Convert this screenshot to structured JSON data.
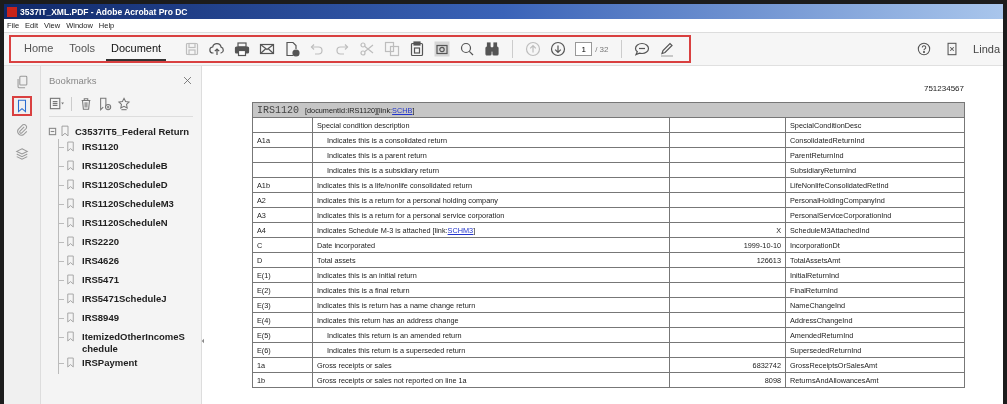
{
  "window": {
    "title": "3537IT_XML.PDF - Adobe Acrobat Pro DC"
  },
  "menu": [
    "File",
    "Edit",
    "View",
    "Window",
    "Help"
  ],
  "toolbar": {
    "tabs": [
      {
        "label": "Home",
        "selected": false
      },
      {
        "label": "Tools",
        "selected": false
      },
      {
        "label": "Document",
        "selected": true
      }
    ],
    "tools": [
      {
        "kind": "floppy-disk",
        "disabled": true
      },
      {
        "kind": "cloud-upload",
        "disabled": false
      },
      {
        "kind": "printer",
        "disabled": false
      },
      {
        "kind": "envelope",
        "disabled": false
      },
      {
        "kind": "file-check",
        "disabled": false
      },
      {
        "kind": "undo",
        "disabled": true
      },
      {
        "kind": "redo",
        "disabled": true
      },
      {
        "kind": "scissors",
        "disabled": true
      },
      {
        "kind": "copy",
        "disabled": true
      },
      {
        "kind": "clipboard",
        "disabled": false
      },
      {
        "kind": "camera",
        "disabled": false
      },
      {
        "kind": "search",
        "disabled": false
      },
      {
        "kind": "binoculars",
        "disabled": false
      },
      {
        "kind": "separator"
      },
      {
        "kind": "arrow-up-circle",
        "disabled": true
      },
      {
        "kind": "arrow-down-circle",
        "disabled": false
      },
      {
        "kind": "page",
        "value": "1",
        "total": "/ 32"
      },
      {
        "kind": "separator"
      },
      {
        "kind": "speech-bubble",
        "disabled": false
      },
      {
        "kind": "pen",
        "disabled": false
      }
    ],
    "user": "Linda"
  },
  "rail": [
    {
      "kind": "pages",
      "selected": false
    },
    {
      "kind": "bookmark",
      "selected": true
    },
    {
      "kind": "paperclip",
      "selected": false
    },
    {
      "kind": "layers",
      "selected": false
    }
  ],
  "bookmarks": {
    "title": "Bookmarks",
    "tree": {
      "label": "C3537IT5_Federal Return",
      "expanded": true,
      "children": [
        {
          "label": "IRS1120"
        },
        {
          "label": "IRS1120ScheduleB"
        },
        {
          "label": "IRS1120ScheduleD"
        },
        {
          "label": "IRS1120ScheduleM3"
        },
        {
          "label": "IRS1120ScheduleN"
        },
        {
          "label": "IRS2220"
        },
        {
          "label": "IRS4626"
        },
        {
          "label": "IRS5471"
        },
        {
          "label": "IRS5471ScheduleJ"
        },
        {
          "label": "IRS8949"
        },
        {
          "label": "ItemizedOtherIncomeSchedule"
        },
        {
          "label": "IRSPayment"
        }
      ]
    }
  },
  "document": {
    "page_number": "751234567",
    "table": {
      "form": "IRS1120",
      "header_text": "[documentId:IRS1120][link:",
      "header_link": "SCHB",
      "header_end": "]",
      "rows": [
        {
          "line": "",
          "description": "Special condition description",
          "indented": false,
          "value": "",
          "tag": "SpecialConditionDesc"
        },
        {
          "line": "A1a",
          "description": "Indicates this is a consolidated return",
          "indented": true,
          "value": "",
          "tag": "ConsolidatedReturnInd"
        },
        {
          "line": "",
          "description": "Indicates this is a parent return",
          "indented": true,
          "value": "",
          "tag": "ParentReturnInd"
        },
        {
          "line": "",
          "description": "Indicates this is a subsidiary return",
          "indented": true,
          "value": "",
          "tag": "SubsidiaryReturnInd"
        },
        {
          "line": "A1b",
          "description": "Indicates this is a life/nonlife consolidated return",
          "indented": false,
          "value": "",
          "tag": "LifeNonlifeConsolidatedRetInd"
        },
        {
          "line": "A2",
          "description": "Indicates this is a return for a personal holding company",
          "indented": false,
          "value": "",
          "tag": "PersonalHoldingCompanyInd"
        },
        {
          "line": "A3",
          "description": "Indicates this is a return for a personal service corporation",
          "indented": false,
          "value": "",
          "tag": "PersonalServiceCorporationInd"
        },
        {
          "line": "A4",
          "description": "Indicates Schedule M-3 is attached [link:",
          "link": "SCHM3",
          "description_end": "]",
          "indented": false,
          "value": "X",
          "tag": "ScheduleM3AttachedInd"
        },
        {
          "line": "C",
          "description": "Date incorporated",
          "indented": false,
          "value": "1999-10-10",
          "tag": "IncorporationDt"
        },
        {
          "line": "D",
          "description": "Total assets",
          "indented": false,
          "value": "126613",
          "tag": "TotalAssetsAmt"
        },
        {
          "line": "E(1)",
          "description": "Indicates this is an initial return",
          "indented": false,
          "value": "",
          "tag": "InitialReturnInd"
        },
        {
          "line": "E(2)",
          "description": "Indicates this is a final return",
          "indented": false,
          "value": "",
          "tag": "FinalReturnInd"
        },
        {
          "line": "E(3)",
          "description": "Indicates this is return has a name change return",
          "indented": false,
          "value": "",
          "tag": "NameChangeInd"
        },
        {
          "line": "E(4)",
          "description": "Indicates this return has an address change",
          "indented": false,
          "value": "",
          "tag": "AddressChangeInd"
        },
        {
          "line": "E(5)",
          "description": "Indicates this return is an amended return",
          "indented": true,
          "value": "",
          "tag": "AmendedReturnInd"
        },
        {
          "line": "E(6)",
          "description": "Indicates this return is a superseded return",
          "indented": true,
          "value": "",
          "tag": "SupersededReturnInd"
        },
        {
          "line": "1a",
          "description": "Gross receipts or sales",
          "indented": false,
          "value": "6832742",
          "tag": "GrossReceiptsOrSalesAmt"
        },
        {
          "line": "1b",
          "description": "Gross receipts or sales not reported on line 1a",
          "indented": false,
          "value": "8098",
          "tag": "ReturnsAndAllowancesAmt"
        }
      ]
    }
  }
}
